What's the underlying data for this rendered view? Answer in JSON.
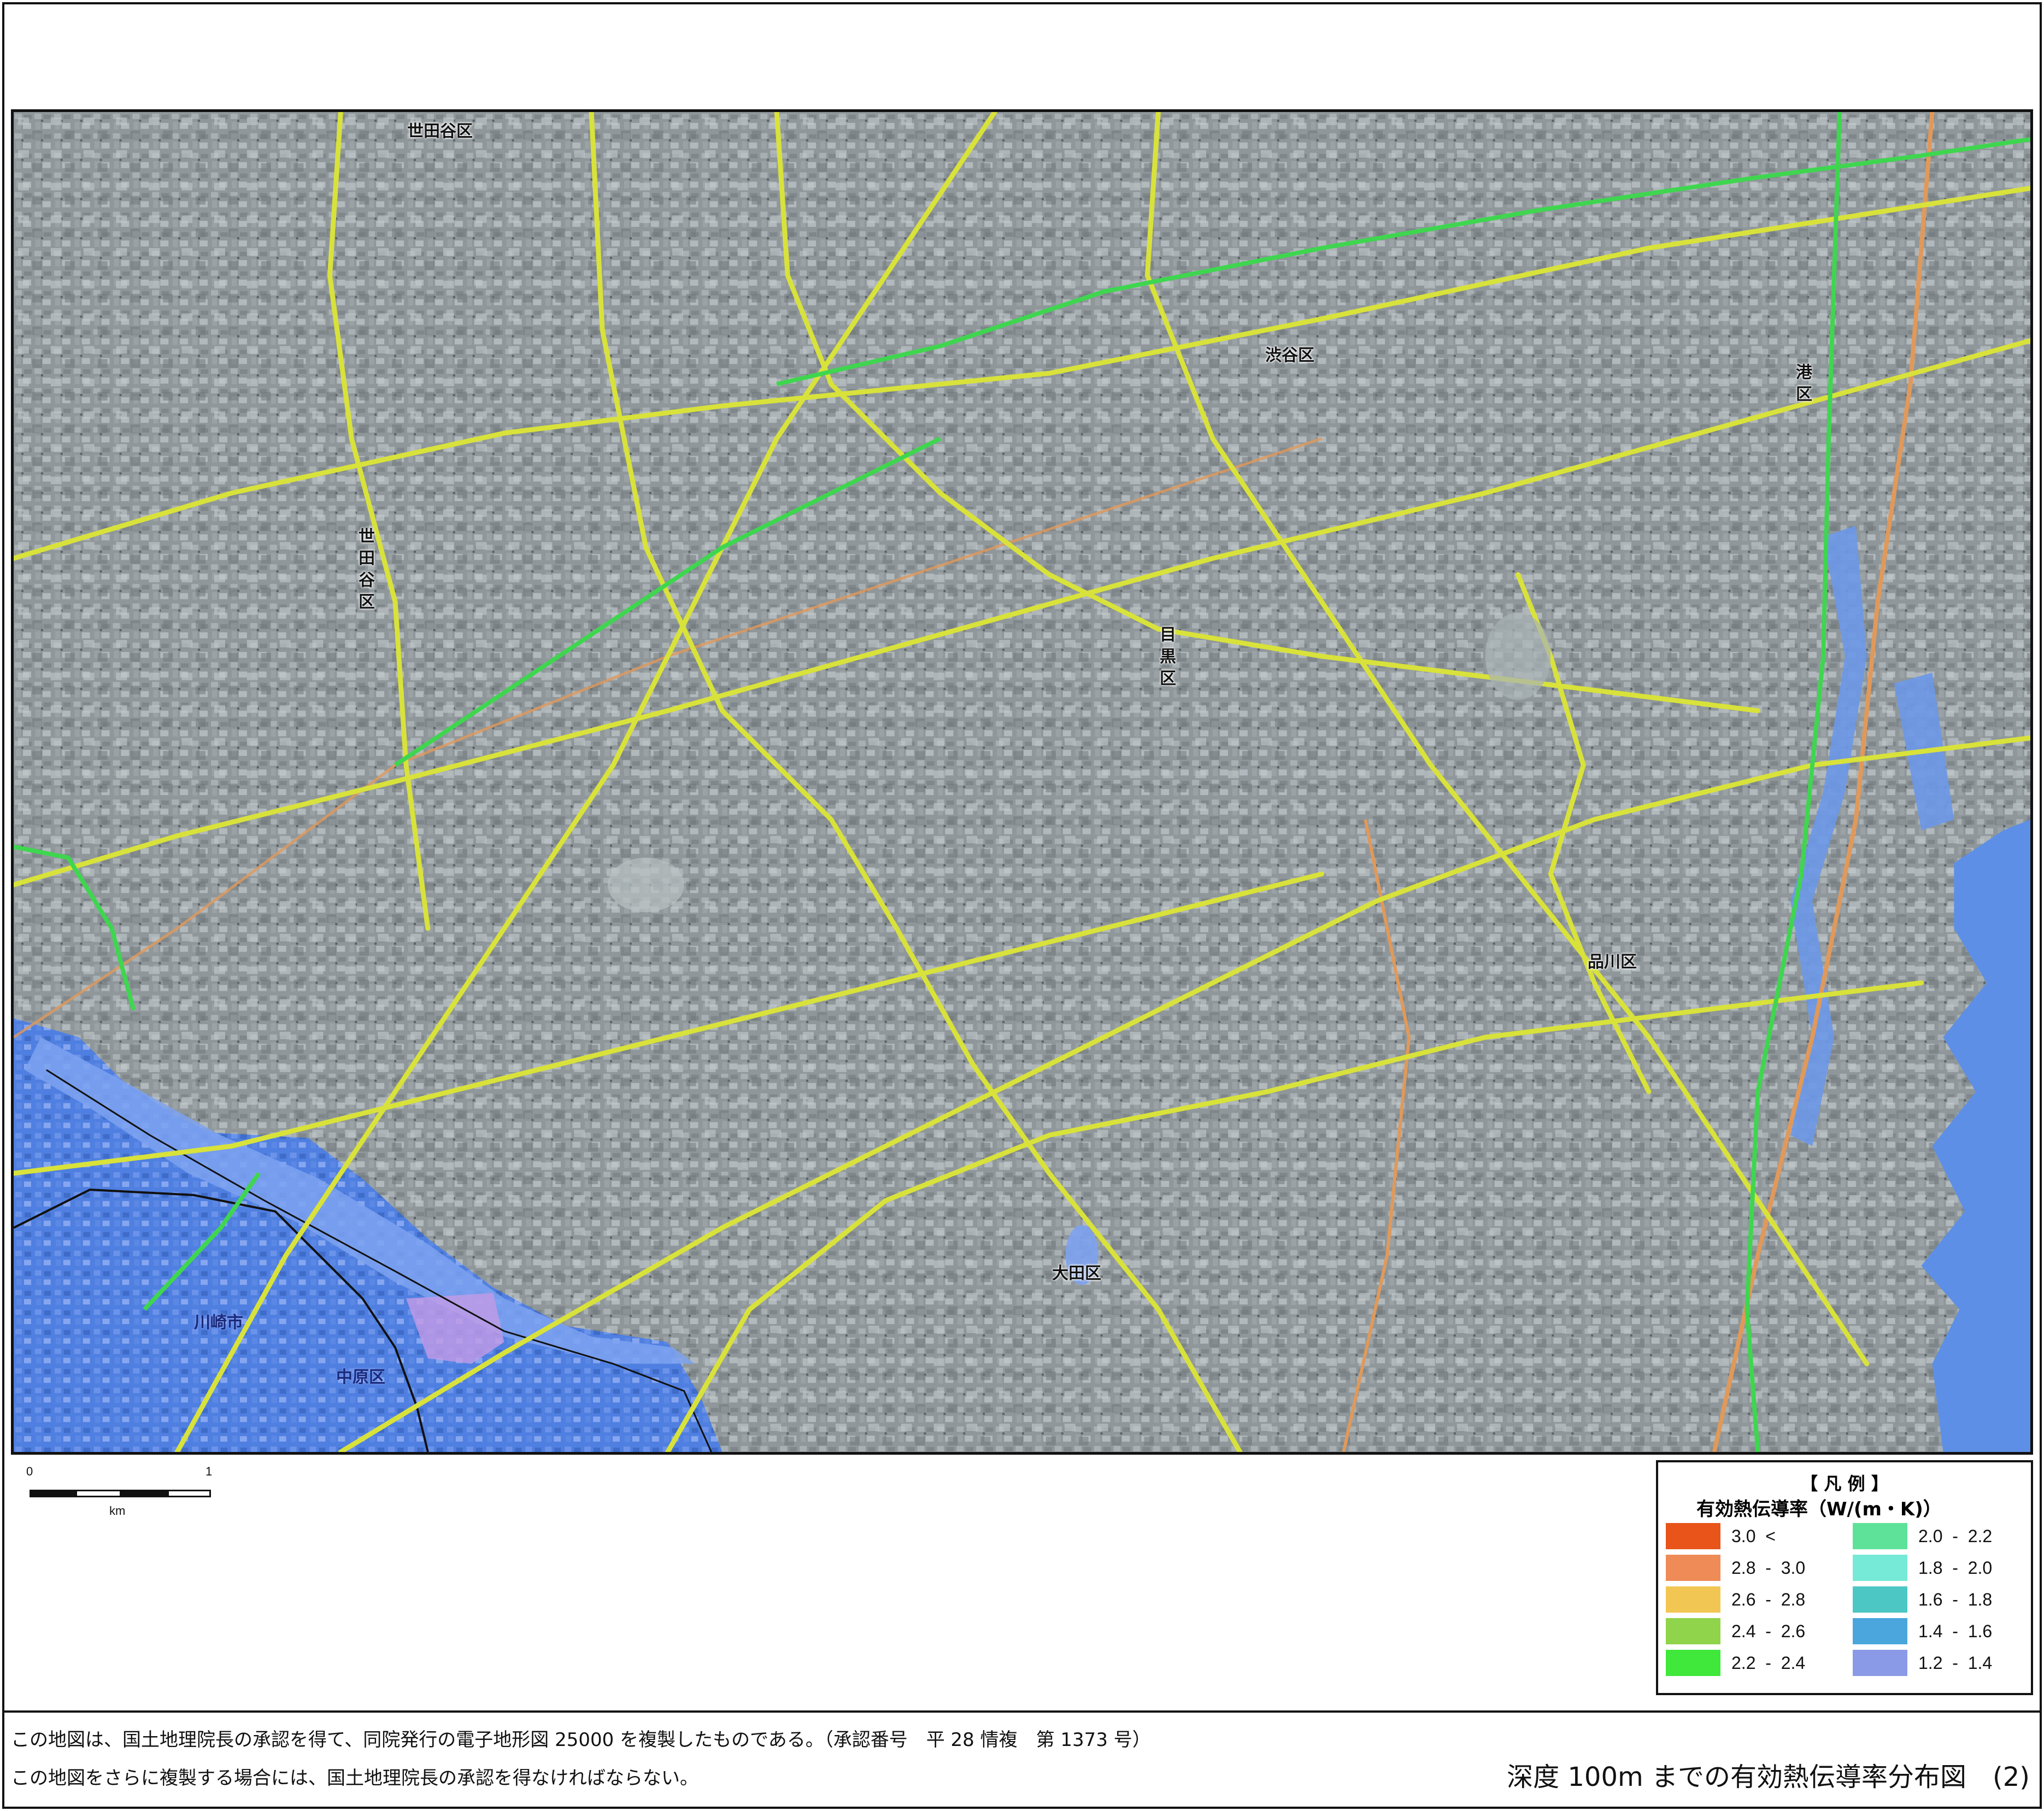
{
  "map": {
    "place_labels": {
      "setagaya_top": "世田谷区",
      "setagaya_vertical": "世田谷区",
      "shibuya": "渋谷区",
      "minato": "港区",
      "meguro": "目黒区",
      "shinagawa": "品川区",
      "ota": "大田区",
      "kawasaki": "川崎市",
      "nakahara": "中原区"
    },
    "colors": {
      "urban_base": "#8d9599",
      "river_area": "#4f7fe0",
      "river_light": "#7da2f0",
      "road_main": "#d8e23a",
      "road_green": "#3fd64f",
      "rail_orange": "#e0995a",
      "bay_water": "#5d8fe6"
    }
  },
  "scale": {
    "zero": "0",
    "one": "1",
    "unit": "km"
  },
  "legend": {
    "title": "【 凡 例 】",
    "subtitle": "有効熱伝導率（W/(m・K)）",
    "left_items": [
      {
        "label": "3.0  <",
        "color": "#e8541a"
      },
      {
        "label": "2.8  -  3.0",
        "color": "#ee8b57"
      },
      {
        "label": "2.6  -  2.8",
        "color": "#f2c652"
      },
      {
        "label": "2.4  -  2.6",
        "color": "#8fd44a"
      },
      {
        "label": "2.2  -  2.4",
        "color": "#3fe83a"
      }
    ],
    "right_items": [
      {
        "label": "2.0  -  2.2",
        "color": "#5ee29a"
      },
      {
        "label": "1.8  -  2.0",
        "color": "#76ead6"
      },
      {
        "label": "1.6  -  1.8",
        "color": "#4cc7c4"
      },
      {
        "label": "1.4  -  1.6",
        "color": "#4aa6dc"
      },
      {
        "label": "1.2  -  1.4",
        "color": "#8a9ae6"
      }
    ]
  },
  "footer": {
    "note_1": "この地図は、国土地理院長の承認を得て、同院発行の電子地形図 25000 を複製したものである。（承認番号　平 28 情複　第 1373 号）",
    "note_2": "この地図をさらに複製する場合には、国土地理院長の承認を得なければならない。",
    "title": "深度 100m までの有効熱伝導率分布図　(2)"
  }
}
